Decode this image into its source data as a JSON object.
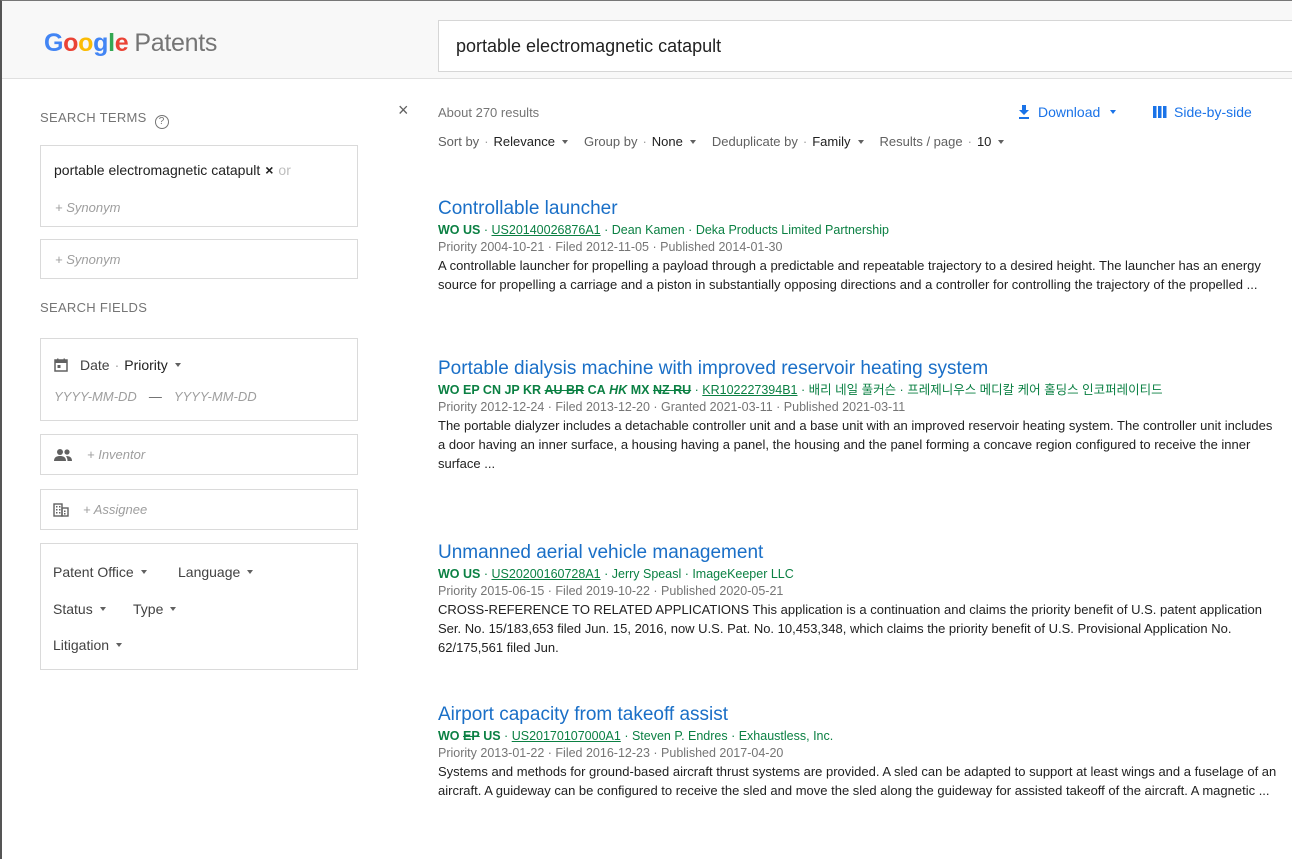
{
  "header": {
    "logo_google": "Google",
    "logo_patents": "Patents",
    "search_value": "portable electromagnetic catapult"
  },
  "sidebar": {
    "search_terms_label": "SEARCH TERMS",
    "help_glyph": "?",
    "term_chip": "portable electromagnetic catapult",
    "chip_remove": "×",
    "chip_or": "or",
    "synonym_placeholder_1": "+ Synonym",
    "synonym_placeholder_2": "+ Synonym",
    "search_fields_label": "SEARCH FIELDS",
    "date_label": "Date",
    "date_separator": "·",
    "date_type": "Priority",
    "date_from_placeholder": "YYYY-MM-DD",
    "date_range_dash": "—",
    "date_to_placeholder": "YYYY-MM-DD",
    "inventor_placeholder": "+ Inventor",
    "assignee_placeholder": "+ Assignee",
    "filters": {
      "patent_office": "Patent Office",
      "language": "Language",
      "status": "Status",
      "type": "Type",
      "litigation": "Litigation"
    }
  },
  "close_glyph": "×",
  "results_header": {
    "about": "About 270 results",
    "download": "Download",
    "side_by_side": "Side-by-side",
    "sort_by_label": "Sort by",
    "sort_by_value": "Relevance",
    "group_by_label": "Group by",
    "group_by_value": "None",
    "dedup_label": "Deduplicate by",
    "dedup_value": "Family",
    "per_page_label": "Results / page",
    "per_page_value": "10",
    "sep": "·"
  },
  "results": [
    {
      "title": "Controllable launcher",
      "countries": "WO US",
      "sep": "·",
      "number": "US20140026876A1",
      "people": "· Dean Kamen · Deka Products Limited Partnership",
      "dates": "Priority 2004-10-21 · Filed 2012-11-05 · Published 2014-01-30",
      "abstract": "A controllable launcher for propelling a payload through a predictable and repeatable trajectory to a desired height. The launcher has an energy source for propelling a carriage and a piston in substantially opposing directions and a controller for controlling the trajectory of the propelled ..."
    },
    {
      "title": "Portable dialysis machine with improved reservoir heating system",
      "countries_a": "WO EP CN JP KR",
      "countries_strike_a": "AU BR",
      "countries_b": "CA",
      "countries_ital": "HK",
      "countries_c": "MX",
      "countries_strike_b": "NZ RU",
      "sep": "·",
      "number": "KR102227394B1",
      "people": "· 배리 네일 풀커슨 · 프레제니우스 메디칼 케어 홀딩스 인코퍼레이티드",
      "dates": "Priority 2012-12-24 · Filed 2013-12-20 · Granted 2021-03-11 · Published 2021-03-11",
      "abstract": "The portable dialyzer includes a detachable controller unit and a base unit with an improved reservoir heating system. The controller unit includes a door having an inner surface, a housing having a panel, the housing and the panel forming a concave region configured to receive the inner surface ..."
    },
    {
      "title": "Unmanned aerial vehicle management",
      "countries": "WO US",
      "sep": "·",
      "number": "US20200160728A1",
      "people": "· Jerry Speasl · ImageKeeper LLC",
      "dates": "Priority 2015-06-15 · Filed 2019-10-22 · Published 2020-05-21",
      "abstract": "CROSS-REFERENCE TO RELATED APPLICATIONS This application is a continuation and claims the priority benefit of U.S. patent application Ser. No. 15/183,653 filed Jun. 15, 2016, now U.S. Pat. No. 10,453,348, which claims the priority benefit of U.S. Provisional Application No. 62/175,561 filed Jun."
    },
    {
      "title": "Airport capacity from takeoff assist",
      "countries_a": "WO",
      "countries_strike": "EP",
      "countries_b": "US",
      "sep": "·",
      "number": "US20170107000A1",
      "people": "· Steven P. Endres · Exhaustless, Inc.",
      "dates": "Priority 2013-01-22 · Filed 2016-12-23 · Published 2017-04-20",
      "abstract": "Systems and methods for ground-based aircraft thrust systems are provided. A sled can be adapted to support at least wings and a fuselage of an aircraft. A guideway can be configured to receive the sled and move the sled along the guideway for assisted takeoff of the aircraft. A magnetic ..."
    }
  ],
  "colors": {
    "link_blue": "#1a6fc7",
    "accent_blue": "#1a73e8",
    "meta_green": "#0b8043",
    "gray_text": "#757575"
  }
}
